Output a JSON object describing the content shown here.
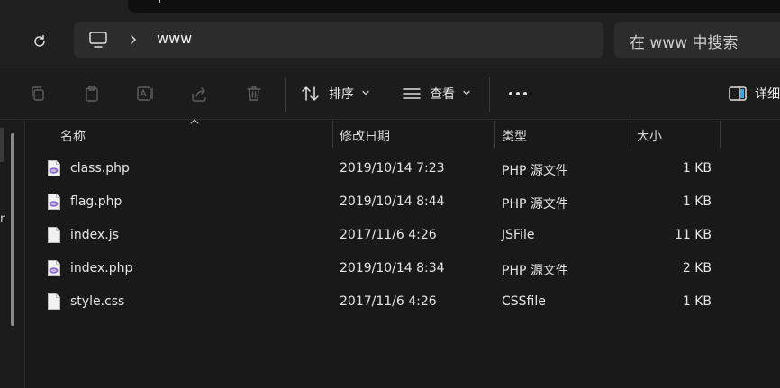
{
  "address": {
    "crumb": "www",
    "search_placeholder": "在 www 中搜索"
  },
  "toolbar": {
    "sort_label": "排序",
    "view_label": "查看",
    "details_label": "详细"
  },
  "left_pane": {
    "cut_text": "r"
  },
  "columns": {
    "name": "名称",
    "modified": "修改日期",
    "type": "类型",
    "size": "大小"
  },
  "files": [
    {
      "name": "class.php",
      "modified": "2019/10/14 7:23",
      "type": "PHP 源文件",
      "size": "1 KB",
      "icon": "php-file-icon"
    },
    {
      "name": "flag.php",
      "modified": "2019/10/14 8:44",
      "type": "PHP 源文件",
      "size": "1 KB",
      "icon": "php-file-icon"
    },
    {
      "name": "index.js",
      "modified": "2017/11/6 4:26",
      "type": "JSFile",
      "size": "11 KB",
      "icon": "blank-file-icon"
    },
    {
      "name": "index.php",
      "modified": "2019/10/14 8:34",
      "type": "PHP 源文件",
      "size": "2 KB",
      "icon": "php-file-icon"
    },
    {
      "name": "style.css",
      "modified": "2017/11/6 4:26",
      "type": "CSSfile",
      "size": "1 KB",
      "icon": "blank-file-icon"
    }
  ],
  "colors": {
    "background": "#191919",
    "address_box": "#2c2c2c",
    "php_icon": "#8b6fc4"
  }
}
